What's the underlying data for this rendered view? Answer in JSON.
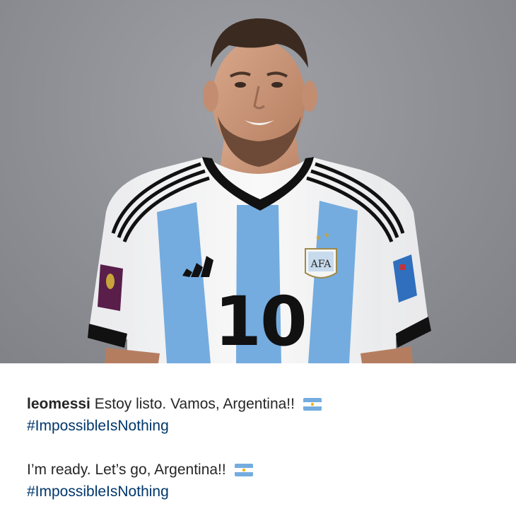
{
  "post": {
    "image_alt": "Lionel Messi wearing the Argentina number 10 jersey",
    "jersey_number": "10",
    "badge_text": "AFA",
    "caption": {
      "username": "leomessi",
      "spanish_text": "Estoy listo. Vamos, Argentina!!",
      "hashtag_1": "#ImpossibleIsNothing",
      "english_text": "I’m ready. Let’s go, Argentina!!",
      "hashtag_2": "#ImpossibleIsNothing",
      "flag_emoji": "argentina-flag-icon"
    }
  },
  "colors": {
    "background": "#8d8f94",
    "jersey_blue": "#74acdf",
    "jersey_white": "#f7f7f7",
    "hashtag": "#00376b",
    "text": "#262626"
  }
}
